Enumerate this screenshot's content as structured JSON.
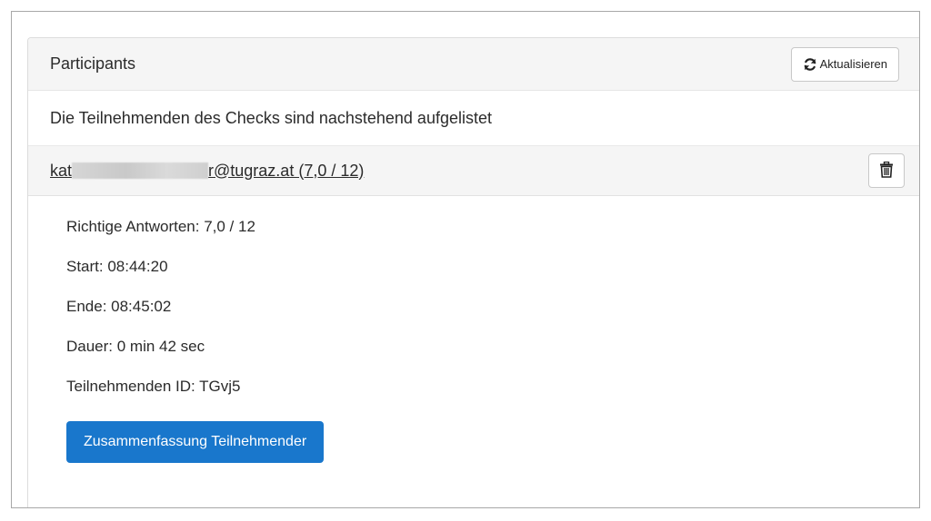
{
  "panel": {
    "title": "Participants",
    "refresh_label": "Aktualisieren",
    "description": "Die Teilnehmenden des Checks sind nachstehend aufgelistet"
  },
  "participant": {
    "email_prefix": "kat",
    "email_suffix": "r@tugraz.at (7,0 / 12)",
    "details": [
      "Richtige Antworten: 7,0 / 12",
      "Start: 08:44:20",
      "Ende: 08:45:02",
      "Dauer: 0 min 42 sec",
      "Teilnehmenden ID: TGvj5"
    ],
    "summary_button_label": "Zusammenfassung Teilnehmender"
  },
  "icons": {
    "refresh": "refresh-icon",
    "delete": "trash-icon"
  },
  "colors": {
    "primary": "#1977cc",
    "header_bg": "#f5f5f5"
  }
}
